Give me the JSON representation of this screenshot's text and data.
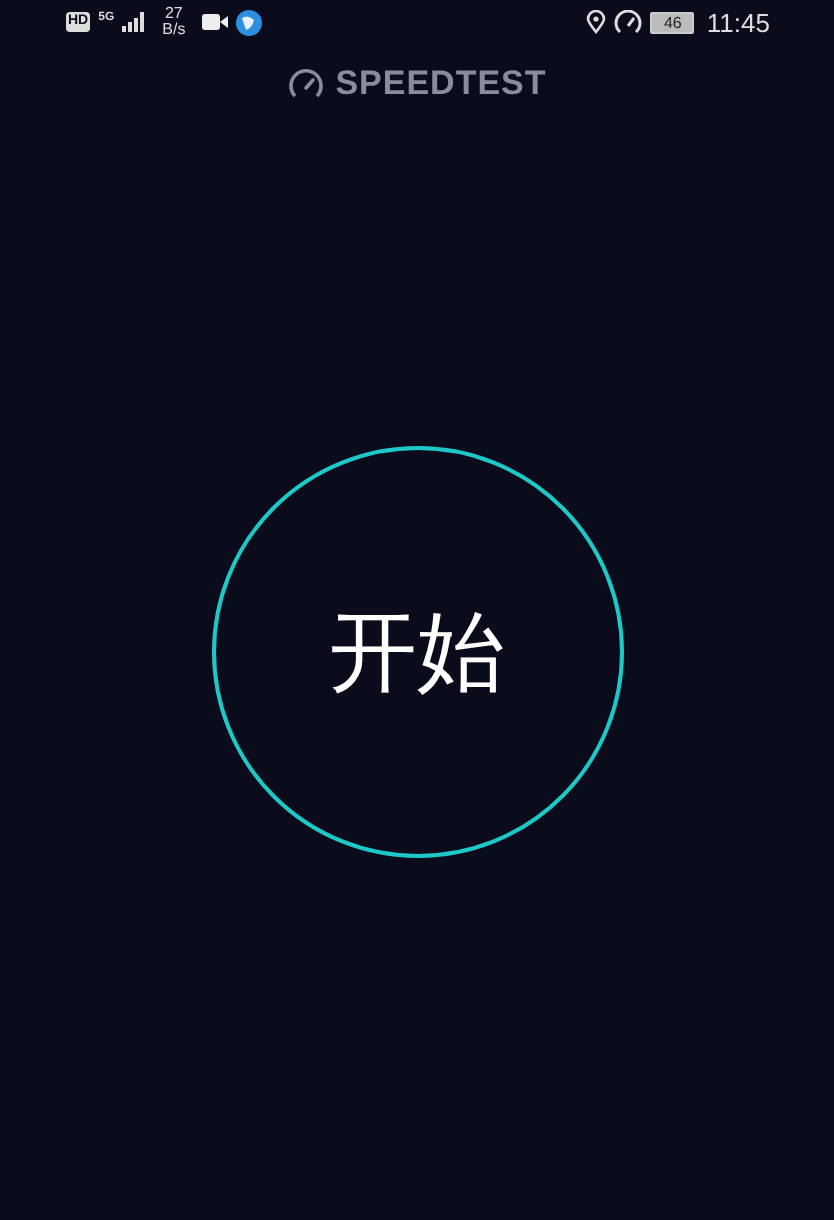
{
  "status_bar": {
    "hd": "HD",
    "network": "5G",
    "speed_value": "27",
    "speed_unit": "B/s",
    "battery": "46",
    "time": "11:45"
  },
  "header": {
    "title": "SPEEDTEST"
  },
  "start_button": {
    "label": "开始"
  }
}
